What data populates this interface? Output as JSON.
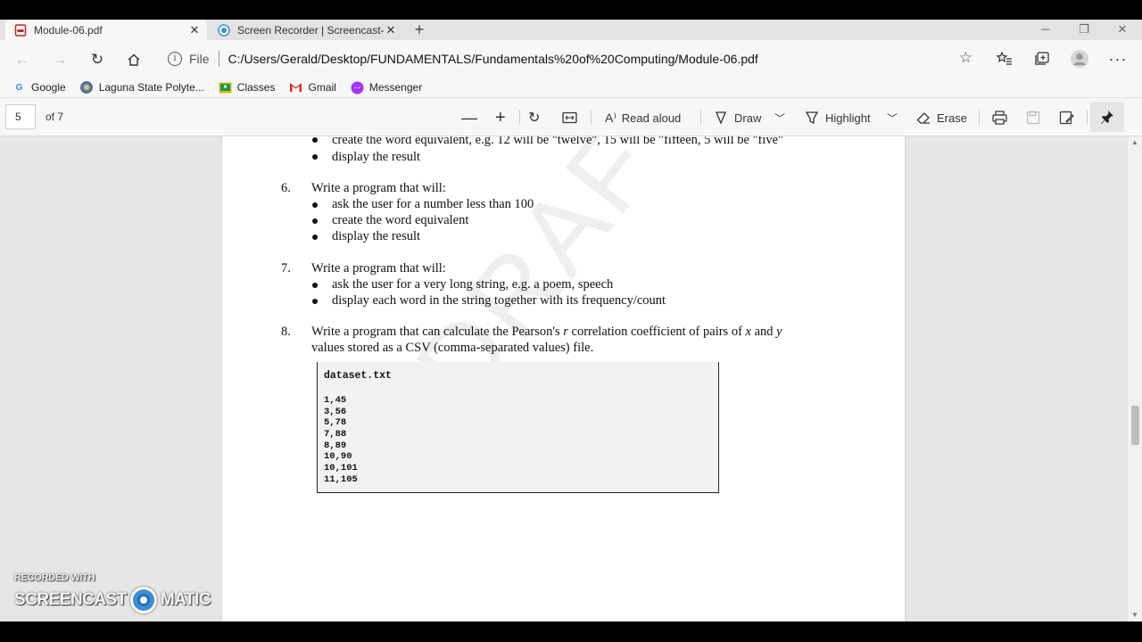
{
  "tabs": [
    {
      "title": "Module-06.pdf",
      "active": true,
      "icon": "pdf-icon"
    },
    {
      "title": "Screen Recorder | Screencast-O-Matic",
      "active": false,
      "icon": "screencast-icon"
    }
  ],
  "address": {
    "scheme": "File",
    "url": "C:/Users/Gerald/Desktop/FUNDAMENTALS/Fundamentals%20of%20Computing/Module-06.pdf"
  },
  "bookmarks": [
    {
      "label": "Google",
      "icon": "google-icon"
    },
    {
      "label": "Laguna State Polyte...",
      "icon": "school-icon"
    },
    {
      "label": "Classes",
      "icon": "classroom-icon"
    },
    {
      "label": "Gmail",
      "icon": "gmail-icon"
    },
    {
      "label": "Messenger",
      "icon": "messenger-icon"
    }
  ],
  "pdf_toolbar": {
    "page_number": "5",
    "page_total": "of 7",
    "read_aloud": "Read aloud",
    "draw": "Draw",
    "highlight": "Highlight",
    "erase": "Erase"
  },
  "document": {
    "top_bullets": [
      "create the word equivalent, e.g. 12 will be \"twelve\", 15 will be \"fifteen, 5 will be \"five\"",
      "display the result"
    ],
    "item6": {
      "number": "6.",
      "text": "Write a program that will:",
      "bullets": [
        "ask the user for a number less than 100",
        "create the word equivalent",
        "display the result"
      ]
    },
    "item7": {
      "number": "7.",
      "text": "Write a program that will:",
      "bullets": [
        "ask the user for a very long string, e.g. a poem, speech",
        "display each word in the string together with its frequency/count"
      ]
    },
    "item8": {
      "number": "8.",
      "line1_a": "Write a program that can calculate the Pearson's ",
      "line1_r": "r",
      "line1_b": " correlation coefficient of pairs of ",
      "line1_x": "x",
      "line1_c": " and ",
      "line1_y": "y",
      "line2": "values stored as a CSV (comma-separated values) file."
    },
    "code": {
      "filename": "dataset.txt",
      "rows": [
        "1,45",
        "3,56",
        "5,78",
        "7,88",
        "8,89",
        "10,90",
        "10,101",
        "11,105"
      ]
    },
    "watermark": "DRAFT COPY"
  },
  "overlay": {
    "recorded_with": "RECORDED WITH",
    "brand_left": "SCREENCAST",
    "brand_right": "MATIC"
  },
  "colors": {
    "pdf_red": "#c8242b",
    "screencast_blue": "#3b8fd6"
  }
}
